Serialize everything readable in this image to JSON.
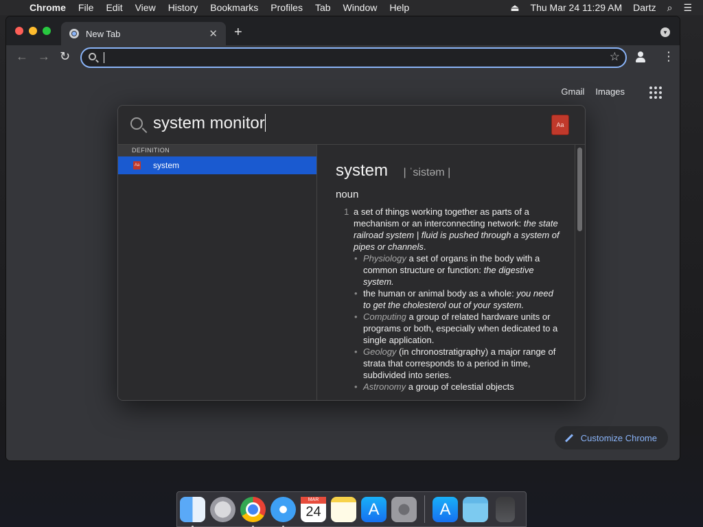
{
  "menubar": {
    "app": "Chrome",
    "items": [
      "File",
      "Edit",
      "View",
      "History",
      "Bookmarks",
      "Profiles",
      "Tab",
      "Window",
      "Help"
    ],
    "datetime": "Thu Mar 24  11:29 AM",
    "user": "Dartz"
  },
  "browser": {
    "tab_title": "New Tab",
    "omnibox_value": "",
    "ntp_links": {
      "gmail": "Gmail",
      "images": "Images"
    },
    "customize_label": "Customize Chrome"
  },
  "spotlight": {
    "query": "system monitor",
    "section_header": "DEFINITION",
    "result_label": "system",
    "definition": {
      "headword": "system",
      "pronunciation": "| ˈsistəm |",
      "part_of_speech": "noun",
      "sense_number": "1",
      "sense_text": "a set of things working together as parts of a mechanism or an interconnecting network: ",
      "sense_example": "the state railroad system | fluid is pushed through a system of pipes or channels",
      "subsenses": [
        {
          "label": "Physiology",
          "text": " a set of organs in the body with a common structure or function: ",
          "example": "the digestive system."
        },
        {
          "label": "",
          "text": "the human or animal body as a whole: ",
          "example": "you need to get the cholesterol out of your system."
        },
        {
          "label": "Computing",
          "text": " a group of related hardware units or programs or both, especially when dedicated to a single application.",
          "example": ""
        },
        {
          "label": "Geology",
          "text": " (in chronostratigraphy) a major range of strata that corresponds to a period in time, subdivided into series.",
          "example": ""
        },
        {
          "label": "Astronomy",
          "text": " a group of celestial objects",
          "example": ""
        }
      ]
    }
  },
  "dock": {
    "calendar_month": "MAR",
    "calendar_day": "24"
  },
  "colors": {
    "selection": "#1a5ad0",
    "link_blue": "#8ab4f8",
    "omnibox_focus": "#8ab4f8"
  }
}
